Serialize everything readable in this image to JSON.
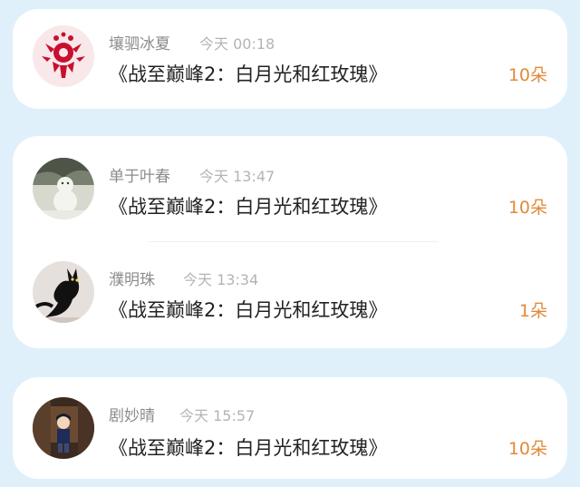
{
  "colors": {
    "background": "#dff0fb",
    "card": "#ffffff",
    "name": "#8c8c8c",
    "time": "#b4b4b4",
    "title": "#222222",
    "count": "#e28a3a"
  },
  "entries": [
    {
      "name": "壤驷冰夏",
      "time": "今天 00:18",
      "title": "《战至巅峰2：白月光和红玫瑰》",
      "count": "10朵",
      "avatar_icon": "red-papercut-avatar-icon"
    },
    {
      "name": "单于叶春",
      "time": "今天 13:47",
      "title": "《战至巅峰2：白月光和红玫瑰》",
      "count": "10朵",
      "avatar_icon": "snowman-photo-avatar-icon"
    },
    {
      "name": "濮明珠",
      "time": "今天 13:34",
      "title": "《战至巅峰2：白月光和红玫瑰》",
      "count": "1朵",
      "avatar_icon": "black-cat-avatar-icon"
    },
    {
      "name": "剧妙晴",
      "time": "今天 15:57",
      "title": "《战至巅峰2：白月光和红玫瑰》",
      "count": "10朵",
      "avatar_icon": "anime-boy-avatar-icon"
    }
  ]
}
